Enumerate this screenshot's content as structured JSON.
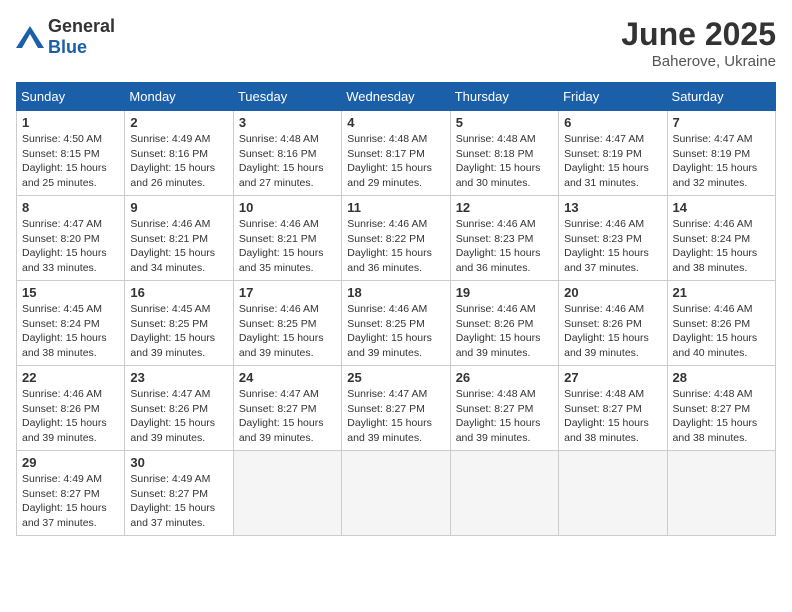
{
  "header": {
    "logo_general": "General",
    "logo_blue": "Blue",
    "month_year": "June 2025",
    "location": "Baherove, Ukraine"
  },
  "columns": [
    "Sunday",
    "Monday",
    "Tuesday",
    "Wednesday",
    "Thursday",
    "Friday",
    "Saturday"
  ],
  "weeks": [
    [
      {
        "day": "1",
        "info": "Sunrise: 4:50 AM\nSunset: 8:15 PM\nDaylight: 15 hours\nand 25 minutes."
      },
      {
        "day": "2",
        "info": "Sunrise: 4:49 AM\nSunset: 8:16 PM\nDaylight: 15 hours\nand 26 minutes."
      },
      {
        "day": "3",
        "info": "Sunrise: 4:48 AM\nSunset: 8:16 PM\nDaylight: 15 hours\nand 27 minutes."
      },
      {
        "day": "4",
        "info": "Sunrise: 4:48 AM\nSunset: 8:17 PM\nDaylight: 15 hours\nand 29 minutes."
      },
      {
        "day": "5",
        "info": "Sunrise: 4:48 AM\nSunset: 8:18 PM\nDaylight: 15 hours\nand 30 minutes."
      },
      {
        "day": "6",
        "info": "Sunrise: 4:47 AM\nSunset: 8:19 PM\nDaylight: 15 hours\nand 31 minutes."
      },
      {
        "day": "7",
        "info": "Sunrise: 4:47 AM\nSunset: 8:19 PM\nDaylight: 15 hours\nand 32 minutes."
      }
    ],
    [
      {
        "day": "8",
        "info": "Sunrise: 4:47 AM\nSunset: 8:20 PM\nDaylight: 15 hours\nand 33 minutes."
      },
      {
        "day": "9",
        "info": "Sunrise: 4:46 AM\nSunset: 8:21 PM\nDaylight: 15 hours\nand 34 minutes."
      },
      {
        "day": "10",
        "info": "Sunrise: 4:46 AM\nSunset: 8:21 PM\nDaylight: 15 hours\nand 35 minutes."
      },
      {
        "day": "11",
        "info": "Sunrise: 4:46 AM\nSunset: 8:22 PM\nDaylight: 15 hours\nand 36 minutes."
      },
      {
        "day": "12",
        "info": "Sunrise: 4:46 AM\nSunset: 8:23 PM\nDaylight: 15 hours\nand 36 minutes."
      },
      {
        "day": "13",
        "info": "Sunrise: 4:46 AM\nSunset: 8:23 PM\nDaylight: 15 hours\nand 37 minutes."
      },
      {
        "day": "14",
        "info": "Sunrise: 4:46 AM\nSunset: 8:24 PM\nDaylight: 15 hours\nand 38 minutes."
      }
    ],
    [
      {
        "day": "15",
        "info": "Sunrise: 4:45 AM\nSunset: 8:24 PM\nDaylight: 15 hours\nand 38 minutes."
      },
      {
        "day": "16",
        "info": "Sunrise: 4:45 AM\nSunset: 8:25 PM\nDaylight: 15 hours\nand 39 minutes."
      },
      {
        "day": "17",
        "info": "Sunrise: 4:46 AM\nSunset: 8:25 PM\nDaylight: 15 hours\nand 39 minutes."
      },
      {
        "day": "18",
        "info": "Sunrise: 4:46 AM\nSunset: 8:25 PM\nDaylight: 15 hours\nand 39 minutes."
      },
      {
        "day": "19",
        "info": "Sunrise: 4:46 AM\nSunset: 8:26 PM\nDaylight: 15 hours\nand 39 minutes."
      },
      {
        "day": "20",
        "info": "Sunrise: 4:46 AM\nSunset: 8:26 PM\nDaylight: 15 hours\nand 39 minutes."
      },
      {
        "day": "21",
        "info": "Sunrise: 4:46 AM\nSunset: 8:26 PM\nDaylight: 15 hours\nand 40 minutes."
      }
    ],
    [
      {
        "day": "22",
        "info": "Sunrise: 4:46 AM\nSunset: 8:26 PM\nDaylight: 15 hours\nand 39 minutes."
      },
      {
        "day": "23",
        "info": "Sunrise: 4:47 AM\nSunset: 8:26 PM\nDaylight: 15 hours\nand 39 minutes."
      },
      {
        "day": "24",
        "info": "Sunrise: 4:47 AM\nSunset: 8:27 PM\nDaylight: 15 hours\nand 39 minutes."
      },
      {
        "day": "25",
        "info": "Sunrise: 4:47 AM\nSunset: 8:27 PM\nDaylight: 15 hours\nand 39 minutes."
      },
      {
        "day": "26",
        "info": "Sunrise: 4:48 AM\nSunset: 8:27 PM\nDaylight: 15 hours\nand 39 minutes."
      },
      {
        "day": "27",
        "info": "Sunrise: 4:48 AM\nSunset: 8:27 PM\nDaylight: 15 hours\nand 38 minutes."
      },
      {
        "day": "28",
        "info": "Sunrise: 4:48 AM\nSunset: 8:27 PM\nDaylight: 15 hours\nand 38 minutes."
      }
    ],
    [
      {
        "day": "29",
        "info": "Sunrise: 4:49 AM\nSunset: 8:27 PM\nDaylight: 15 hours\nand 37 minutes."
      },
      {
        "day": "30",
        "info": "Sunrise: 4:49 AM\nSunset: 8:27 PM\nDaylight: 15 hours\nand 37 minutes."
      },
      null,
      null,
      null,
      null,
      null
    ]
  ]
}
